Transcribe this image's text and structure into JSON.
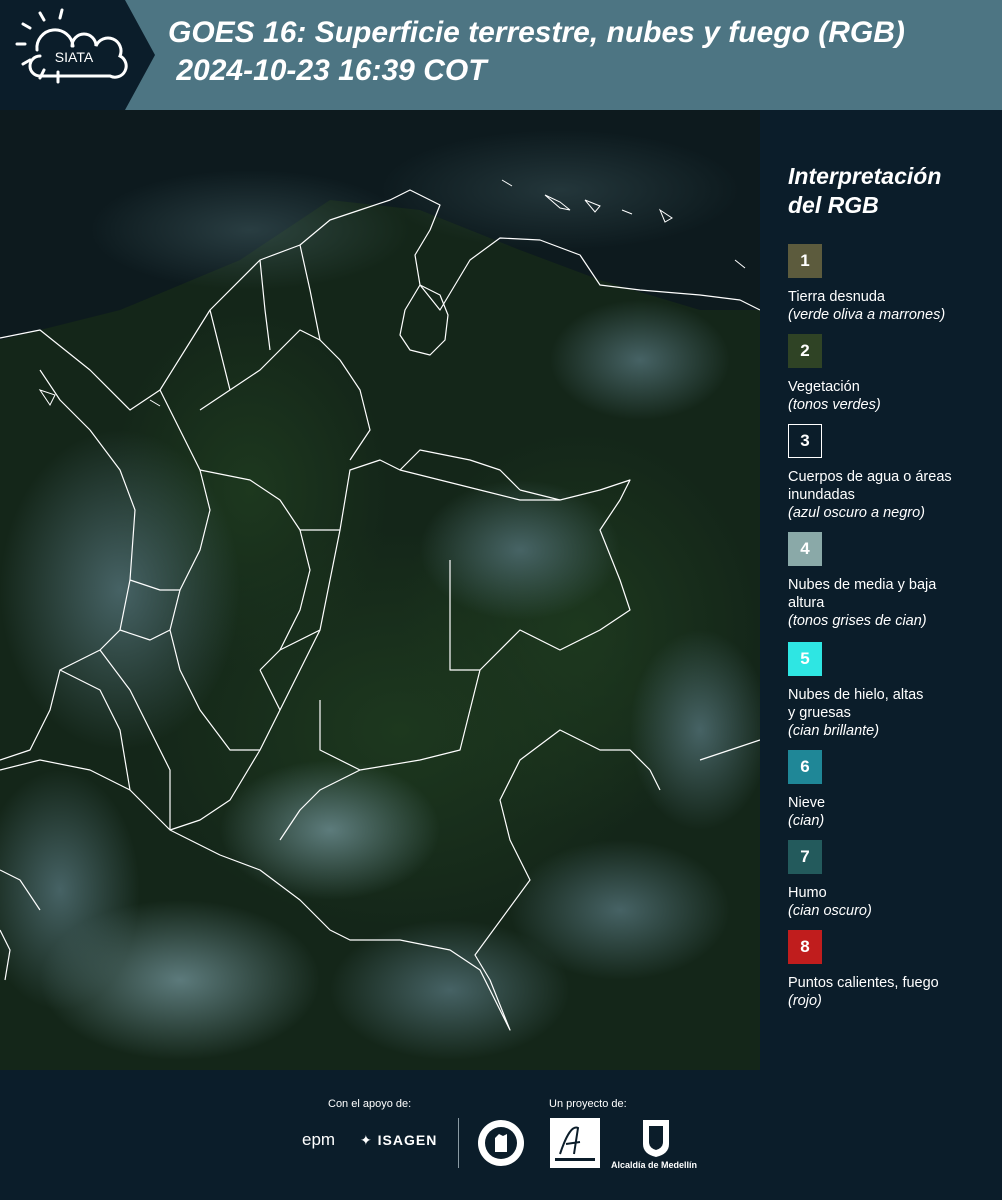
{
  "header": {
    "title_line1": "GOES 16: Superficie terrestre, nubes y fuego (RGB)",
    "title_line2": " 2024-10-23 16:39 COT",
    "logo_text": "SIATA",
    "background": "#4d7583"
  },
  "legend": {
    "title_line1": "Interpretación",
    "title_line2": "del RGB",
    "items": [
      {
        "number": "1",
        "color": "#5c5b3d",
        "label": "Tierra desnuda",
        "hint": "(verde oliva a marrones)"
      },
      {
        "number": "2",
        "color": "#2f4325",
        "label": "Vegetación",
        "hint": "(tonos verdes)"
      },
      {
        "number": "3",
        "color": "#0b1d2a",
        "label": "Cuerpos de agua o áreas inundadas",
        "hint": "(azul oscuro a negro)"
      },
      {
        "number": "4",
        "color": "#8aa9a8",
        "label": "Nubes de media y baja altura",
        "hint": "(tonos grises de cian)"
      },
      {
        "number": "5",
        "color": "#2ee6e3",
        "label": "Nubes de hielo, altas y gruesas",
        "hint": "(cian brillante)"
      },
      {
        "number": "6",
        "color": "#1f8797",
        "label": "Nieve",
        "hint": "(cian)"
      },
      {
        "number": "7",
        "color": "#235a5c",
        "label": "Humo",
        "hint": "(cian oscuro)"
      },
      {
        "number": "8",
        "color": "#c01d1d",
        "label": "Puntos calientes, fuego",
        "hint": "(rojo)"
      }
    ]
  },
  "footer": {
    "support_label": "Con el apoyo de:",
    "project_label": "Un proyecto de:",
    "sponsors": [
      "epm",
      "ISAGEN"
    ],
    "partners": [
      "Área Metropolitana",
      "Alcaldía de Medellín"
    ],
    "alcaldia_text": "Alcaldía de Medellín"
  },
  "map": {
    "description_icon": "satellite-rgb-image-colombia"
  }
}
